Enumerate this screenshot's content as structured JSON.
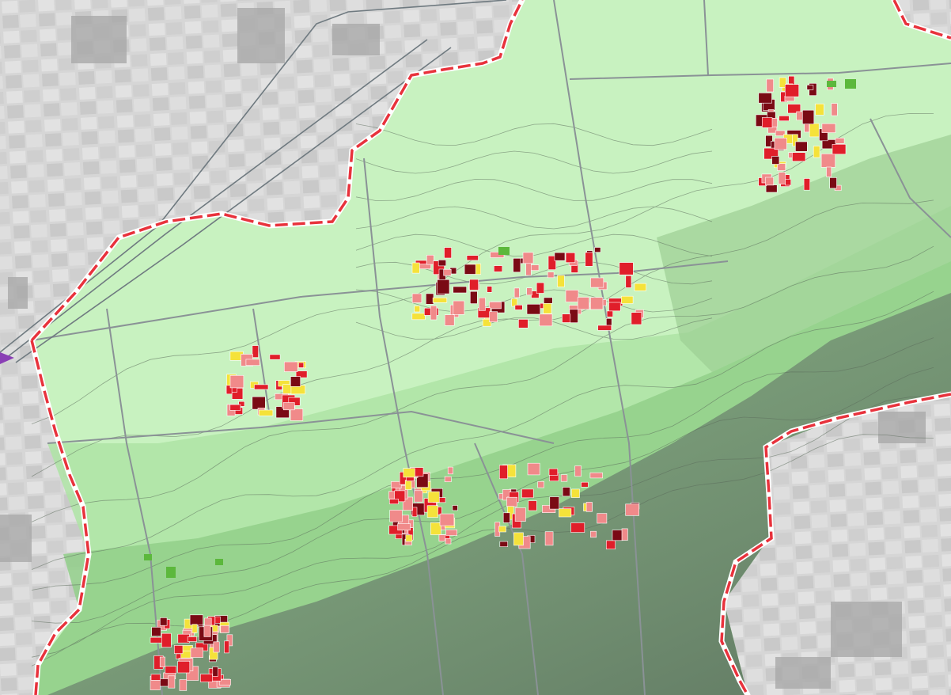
{
  "map": {
    "colors": {
      "outside_background": "#dcdcdc",
      "field_line": "#b5b5b5",
      "zone_light_green": "#c8f2c0",
      "zone_mid_green": "#a8e29e",
      "zone_deep_green": "#8fcc86",
      "zone_slope_grey": "#8a9a8a",
      "boundary_red": "#e8323c",
      "boundary_white": "#ffffff",
      "road": "#8a9296",
      "railway": "#6f7a80",
      "contour": "#5a6a5a",
      "building_pink": "#f08a8a",
      "building_red": "#e01e2a",
      "building_dark_red": "#7a0a14",
      "building_yellow": "#f5e23a",
      "building_green": "#5cb83c"
    },
    "villages": [
      {
        "id": "northeast-village",
        "building_count": 60
      },
      {
        "id": "central-north-village",
        "building_count": 90
      },
      {
        "id": "west-village",
        "building_count": 35
      },
      {
        "id": "central-south-village",
        "building_count": 55
      },
      {
        "id": "southeast-village",
        "building_count": 45
      },
      {
        "id": "southwest-village",
        "building_count": 60
      }
    ]
  }
}
